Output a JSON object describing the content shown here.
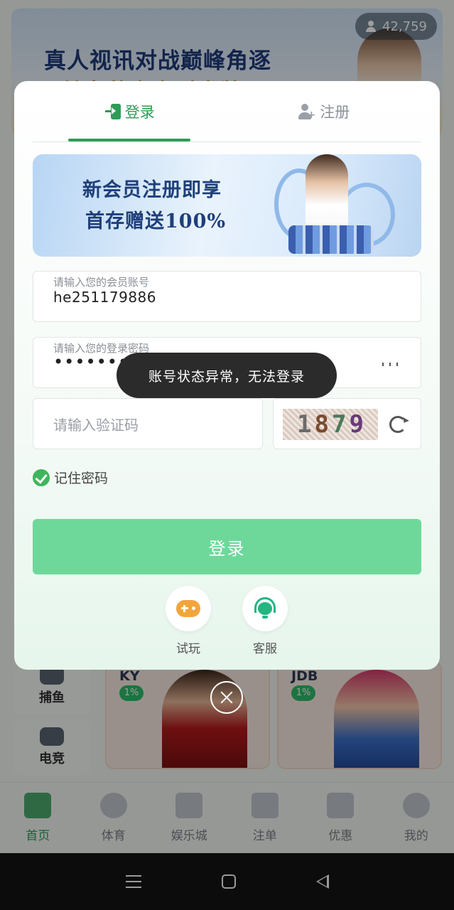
{
  "background": {
    "banner": {
      "line1": "真人视讯对战巅峰角逐",
      "line2": "美女荷官实时发牌"
    },
    "online_count": "42,759",
    "side_categories": [
      {
        "label": "捕鱼",
        "icon": "fish-icon"
      },
      {
        "label": "电竞",
        "icon": "gamepad-icon"
      }
    ],
    "game_cards": [
      {
        "title": "KY",
        "rate": "1%"
      },
      {
        "title": "JDB",
        "rate": "1%"
      }
    ]
  },
  "bottom_nav": {
    "items": [
      {
        "label": "首页",
        "icon": "home-icon",
        "active": true
      },
      {
        "label": "体育",
        "icon": "sports-ball-icon",
        "active": false
      },
      {
        "label": "娱乐城",
        "icon": "casino-icon",
        "active": false
      },
      {
        "label": "注单",
        "icon": "bets-list-icon",
        "active": false
      },
      {
        "label": "优惠",
        "icon": "gift-icon",
        "active": false
      },
      {
        "label": "我的",
        "icon": "profile-icon",
        "active": false
      }
    ]
  },
  "modal": {
    "tabs": [
      {
        "label": "登录",
        "icon": "login-icon",
        "active": true
      },
      {
        "label": "注册",
        "icon": "add-user-icon",
        "active": false
      }
    ],
    "promo": {
      "line1": "新会员注册即享",
      "line2": "首存赠送100%"
    },
    "account_field": {
      "label": "请输入您的会员账号",
      "value": "he251179886"
    },
    "password_field": {
      "label": "请输入您的登录密码",
      "value": "••••••••"
    },
    "captcha_field": {
      "placeholder": "请输入验证码",
      "code_digits": [
        "1",
        "8",
        "7",
        "9"
      ],
      "digit_colors": [
        "#6b6b6b",
        "#7a4a2e",
        "#4a7a5a",
        "#6a3a7a"
      ]
    },
    "remember": {
      "label": "记住密码",
      "checked": true
    },
    "login_button": "登录",
    "quick_actions": [
      {
        "label": "试玩",
        "icon": "gamepad-icon"
      },
      {
        "label": "客服",
        "icon": "headset-icon"
      }
    ]
  },
  "toast": {
    "message": "账号状态异常，无法登录"
  },
  "colors": {
    "accent": "#2e9c57",
    "login_button": "#6ed89a",
    "toast_bg": "#2b2b2b"
  }
}
